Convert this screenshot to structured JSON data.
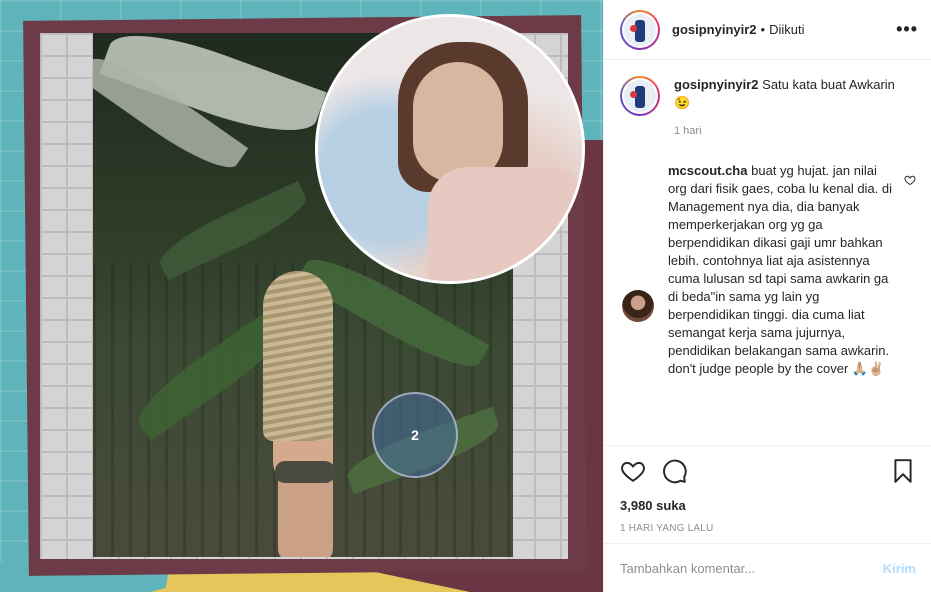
{
  "post": {
    "username": "gosipnyinyir2",
    "separator": "•",
    "follow_status": "Diikuti",
    "more_label": "•••",
    "watermark_text": "2"
  },
  "caption": {
    "username": "gosipnyinyir2",
    "text": "Satu kata buat Awkarin",
    "emoji": "😉",
    "time": "1 hari"
  },
  "comments": [
    {
      "username": "mcscout.cha",
      "text": "buat yg hujat. jan nilai org dari fisik gaes, coba lu kenal dia. di Management nya dia, dia banyak memperkerjakan org yg ga berpendidikan dikasi gaji umr bahkan lebih. contohnya liat aja asistennya cuma lulusan sd tapi sama awkarin ga di beda\"in sama yg lain yg berpendidikan tinggi. dia cuma liat semangat kerja sama jujurnya, pendidikan belakangan sama awkarin. don't judge people by the cover",
      "emoji": "🙏🏼✌🏼",
      "like_icon": "heart-outline-icon"
    }
  ],
  "actions": {
    "likes": "3,980 suka",
    "time_ago": "1 HARI YANG LALU"
  },
  "add_comment": {
    "placeholder": "Tambahkan komentar...",
    "post_label": "Kirim"
  },
  "colors": {
    "post_button_disabled": "#b3dbff",
    "secondary_text": "#8e8e8e",
    "primary_text": "#262626"
  }
}
